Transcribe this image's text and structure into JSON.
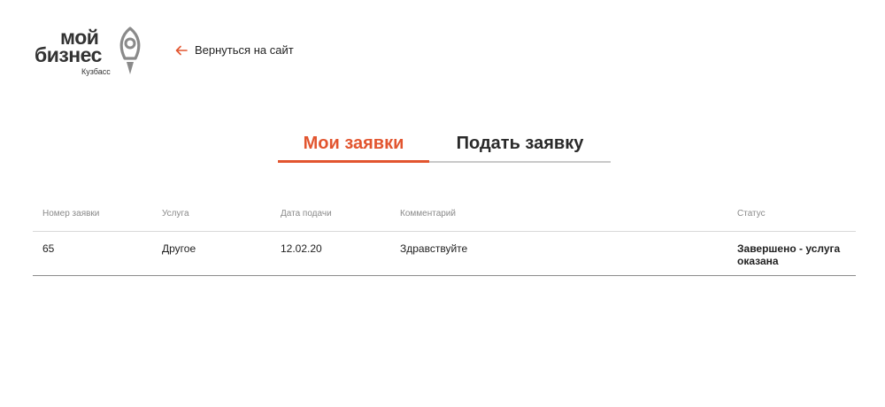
{
  "header": {
    "logo": {
      "word_top": "мой",
      "word_bottom": "бизнес",
      "region": "Кузбасс"
    },
    "back_link": {
      "label": "Вернуться на сайт",
      "icon": "arrow-left-icon",
      "icon_color": "#e2552f"
    }
  },
  "tabs": [
    {
      "label": "Мои заявки",
      "active": true
    },
    {
      "label": "Подать заявку",
      "active": false
    }
  ],
  "colors": {
    "accent": "#e2552f",
    "text": "#222222",
    "muted": "#8a8a8a"
  },
  "table": {
    "columns": [
      "Номер заявки",
      "Услуга",
      "Дата подачи",
      "Комментарий",
      "Статус"
    ],
    "rows": [
      {
        "number": "65",
        "service": "Другое",
        "date": "12.02.20",
        "comment": "Здравствуйте",
        "status": "Завершено - услуга оказана"
      }
    ]
  }
}
